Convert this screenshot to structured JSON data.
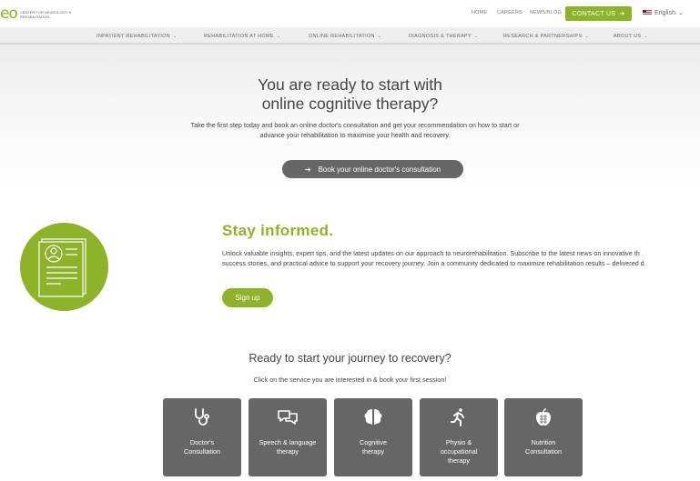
{
  "header": {
    "logo_mark": "eo",
    "logo_text": "CENTER FOR NEUROLOGY & REHABILITATION",
    "top_links": [
      "HOME",
      "CAREERS",
      "NEWS/BLOG"
    ],
    "contact_label": "CONTACT US",
    "language": "English"
  },
  "nav": {
    "items": [
      "INPATIENT REHABILITATION",
      "REHABILITATION AT HOME",
      "ONLINE REHABILITATION",
      "DIAGNOSIS & THERAPY",
      "RESEARCH & PARTNERSHIPS",
      "ABOUT US"
    ]
  },
  "hero": {
    "title_line1": "You are ready to start with",
    "title_line2": "online cognitive therapy?",
    "text_line1": "Take the first step today and book an online doctor's consultation and get your recommendation on how to start or",
    "text_line2": "advance your rehabilitation to maximise your health and recovery.",
    "button_label": "Book your online doctor's consultation"
  },
  "newsletter": {
    "title": "Stay informed.",
    "text_line1": "Unlock valuable insights, expert tips, and the latest updates on our approach to neurorehabilitation. Subscribe to the latest news on innovative th",
    "text_line2": "success stories, and practical advice to support your recovery journey. Join a community dedicated to maximize rehabilitation results – delivered d",
    "button_label": "Sign up"
  },
  "journey": {
    "title": "Ready to start your journey to recovery?",
    "subtitle": "Click on the service you are interested in & book your first session!",
    "cards": [
      {
        "line1": "Doctor's",
        "line2": "Consultation",
        "line3": "",
        "icon": "stethoscope-icon"
      },
      {
        "line1": "Speech & language",
        "line2": "therapy",
        "line3": "",
        "icon": "speech-bubbles-icon"
      },
      {
        "line1": "Cognitive",
        "line2": "therapy",
        "line3": "",
        "icon": "brain-icon"
      },
      {
        "line1": "Physio &",
        "line2": "occupational",
        "line3": "therapy",
        "icon": "running-person-icon"
      },
      {
        "line1": "Nutrition",
        "line2": "Consultation",
        "line3": "",
        "icon": "apple-icon"
      }
    ]
  },
  "colors": {
    "brand_green": "#8db32a",
    "button_gray": "#666666",
    "text": "#444444"
  }
}
